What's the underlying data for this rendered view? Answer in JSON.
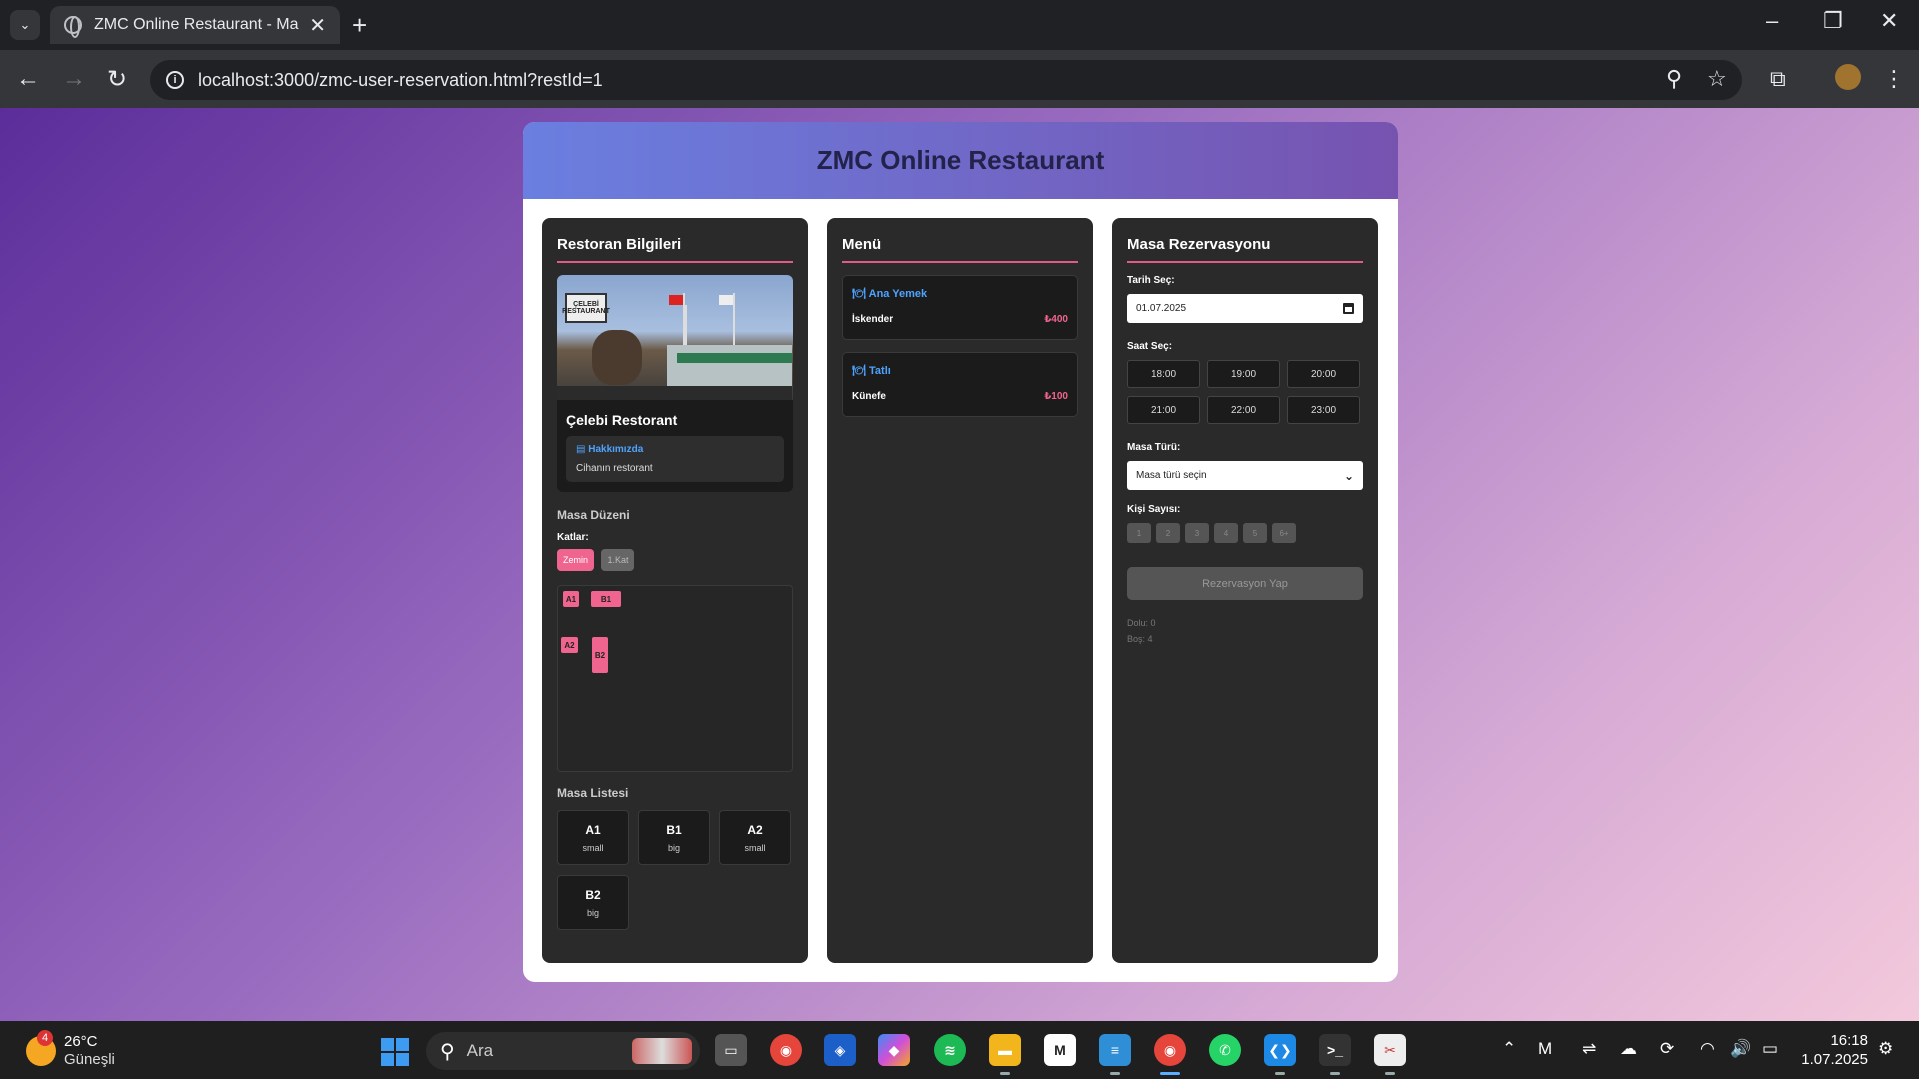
{
  "browser": {
    "tab_title": "ZMC Online Restaurant - Masa R",
    "url": "localhost:3000/zmc-user-reservation.html?restId=1"
  },
  "app": {
    "title": "ZMC Online Restaurant"
  },
  "restaurant": {
    "heading": "Restoran Bilgileri",
    "image_sign": "ÇELEBİ RESTAURANT",
    "name": "Çelebi Restorant",
    "about_title": "Hakkımızda",
    "about_text": "Cihanın restorant",
    "layout_heading": "Masa Düzeni",
    "floors_label": "Katlar:",
    "floors": [
      "Zemin",
      "1.Kat"
    ],
    "active_floor": "Zemin",
    "layout_tables": [
      "A1",
      "B1",
      "A2",
      "B2"
    ],
    "list_heading": "Masa Listesi",
    "tables": [
      {
        "name": "A1",
        "size": "small"
      },
      {
        "name": "B1",
        "size": "big"
      },
      {
        "name": "A2",
        "size": "small"
      },
      {
        "name": "B2",
        "size": "big"
      }
    ]
  },
  "menu": {
    "heading": "Menü",
    "categories": [
      {
        "name": "Ana Yemek",
        "item": "İskender",
        "price": "₺400"
      },
      {
        "name": "Tatlı",
        "item": "Künefe",
        "price": "₺100"
      }
    ]
  },
  "reservation": {
    "heading": "Masa Rezervasyonu",
    "date_label": "Tarih Seç:",
    "date_value": "01.07.2025",
    "time_label": "Saat Seç:",
    "times": [
      "18:00",
      "19:00",
      "20:00",
      "21:00",
      "22:00",
      "23:00"
    ],
    "table_type_label": "Masa Türü:",
    "table_type_placeholder": "Masa türü seçin",
    "people_label": "Kişi Sayısı:",
    "people": [
      "1",
      "2",
      "3",
      "4",
      "5",
      "6+"
    ],
    "submit_label": "Rezervasyon Yap",
    "full": "Dolu: 0",
    "empty": "Boş: 4"
  },
  "taskbar": {
    "weather_badge": "4",
    "temperature": "26°C",
    "condition": "Güneşli",
    "search_label": "Ara",
    "time": "16:18",
    "date": "1.07.2025"
  },
  "colors": {
    "accent_pink": "#f0658f",
    "link_blue": "#4ea3ff",
    "panel_bg": "#2a2a2a",
    "header_gradient_start": "#6a7fe0",
    "header_gradient_end": "#7753b0"
  }
}
